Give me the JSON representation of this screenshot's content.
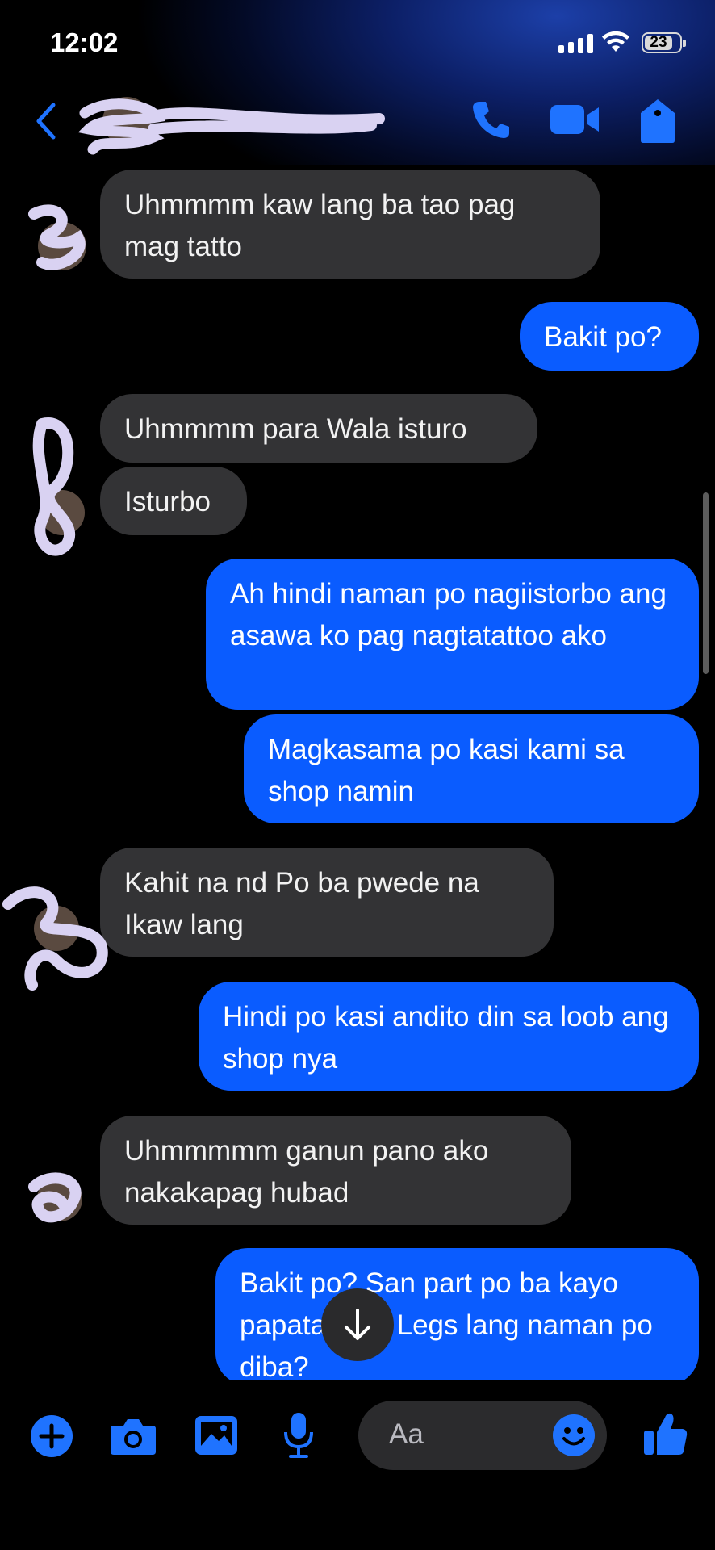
{
  "status": {
    "time": "12:02",
    "battery": "23"
  },
  "header": {
    "contact_name": ""
  },
  "messages": [
    {
      "dir": "in",
      "text": "Uhmmmm kaw lang ba tao pag mag tatto"
    },
    {
      "dir": "out",
      "text": "Bakit po?"
    },
    {
      "dir": "in",
      "text": "Uhmmmm para Wala isturo"
    },
    {
      "dir": "in",
      "text": "Isturbo"
    },
    {
      "dir": "out",
      "text": "Ah hindi naman po nagiistorbo ang asawa ko pag nagtatattoo ako"
    },
    {
      "dir": "out",
      "text": "Magkasama po kasi kami sa shop namin"
    },
    {
      "dir": "in",
      "text": "Kahit na nd Po ba pwede na Ikaw lang"
    },
    {
      "dir": "out",
      "text": "Hindi po kasi andito din sa loob ang shop nya"
    },
    {
      "dir": "in",
      "text": "Uhmmmmm ganun pano ako nakakapag hubad"
    },
    {
      "dir": "out",
      "text": "Bakit po? San part po ba kayo papatattoo? Legs lang naman po diba?"
    }
  ],
  "composer": {
    "placeholder": "Aa"
  },
  "icons": {
    "back": "chevron-left-icon",
    "call": "phone-icon",
    "video": "video-camera-icon",
    "info": "tag-icon",
    "plus": "plus-icon",
    "camera": "camera-icon",
    "gallery": "image-icon",
    "mic": "microphone-icon",
    "emoji": "smiley-icon",
    "like": "thumbs-up-icon",
    "scroll_down": "arrow-down-icon"
  },
  "colors": {
    "accent": "#0a5cff",
    "incoming_bubble": "#333335",
    "icon_blue": "#1f73ff"
  }
}
